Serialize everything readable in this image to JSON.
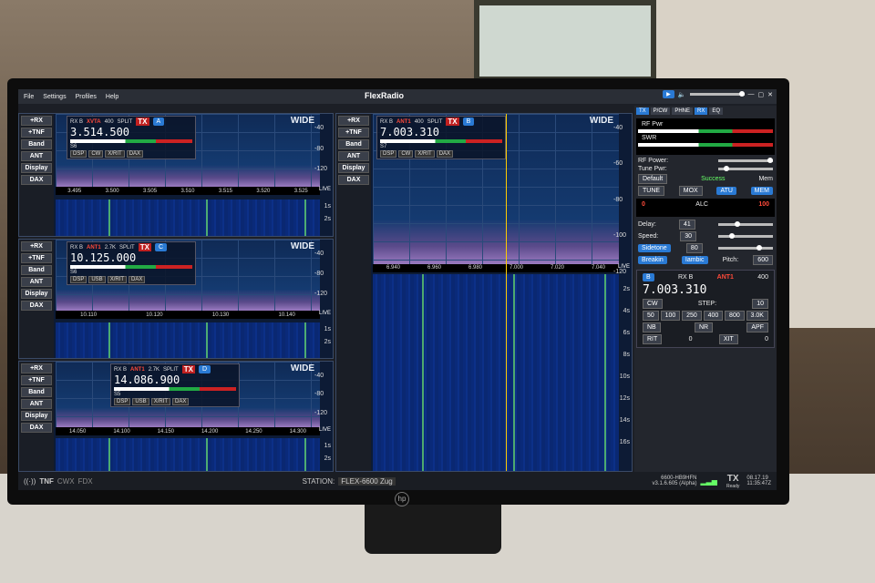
{
  "menu": {
    "file": "File",
    "settings": "Settings",
    "profiles": "Profiles",
    "help": "Help",
    "brand": "FlexRadio"
  },
  "side_buttons": [
    "+RX",
    "+TNF",
    "Band",
    "ANT",
    "Display",
    "DAX"
  ],
  "pan1": {
    "wide": "WIDE",
    "rx": "RX B",
    "ant": "XVTA",
    "bw": "400",
    "split": "SPLIT",
    "tx": "TX",
    "letter": "A",
    "freq": "3.514.500",
    "smeter": "S6",
    "modes": [
      "DSP",
      "CW",
      "X/RIT",
      "DAX"
    ],
    "scale": [
      "-40",
      "-80",
      "-120"
    ],
    "ticks": [
      "3.495",
      "3.500",
      "3.505",
      "3.510",
      "3.515",
      "3.520",
      "3.525"
    ],
    "times": [
      "1s",
      "2s"
    ]
  },
  "pan2": {
    "wide": "WIDE",
    "rx": "RX B",
    "ant": "ANT1",
    "bw": "2.7K",
    "split": "SPLIT",
    "tx": "TX",
    "letter": "C",
    "freq": "10.125.000",
    "smeter": "S6",
    "modes": [
      "DSP",
      "USB",
      "X/RIT",
      "DAX"
    ],
    "scale": [
      "-40",
      "-80",
      "-120"
    ],
    "ticks": [
      "10.110",
      "10.120",
      "10.130",
      "10.140"
    ],
    "times": [
      "1s",
      "2s"
    ]
  },
  "pan3": {
    "wide": "WIDE",
    "rx": "RX B",
    "ant": "ANT1",
    "bw": "2.7K",
    "split": "SPLIT",
    "tx": "TX",
    "letter": "D",
    "freq": "14.086.900",
    "smeter": "S5",
    "modes": [
      "DSP",
      "USB",
      "X/RIT",
      "DAX"
    ],
    "scale": [
      "-40",
      "-80",
      "-120"
    ],
    "ticks": [
      "14.050",
      "14.100",
      "14.150",
      "14.200",
      "14.250",
      "14.300"
    ],
    "times": [
      "1s",
      "2s"
    ]
  },
  "pan4": {
    "wide": "WIDE",
    "rx": "RX B",
    "ant": "ANT1",
    "bw": "400",
    "split": "SPLIT",
    "tx": "TX",
    "letter": "B",
    "freq": "7.003.310",
    "smeter": "S7",
    "modes": [
      "DSP",
      "CW",
      "X/RIT",
      "DAX"
    ],
    "scale": [
      "-40",
      "-60",
      "-80",
      "-100",
      "-120"
    ],
    "ticks": [
      "6.940",
      "6.960",
      "6.980",
      "7.000",
      "7.020",
      "7.040"
    ],
    "times": [
      "2s",
      "4s",
      "6s",
      "8s",
      "10s",
      "12s",
      "14s",
      "16s"
    ]
  },
  "live": "LIVE",
  "right": {
    "tabs": [
      "TX",
      "P/CW",
      "PHNE",
      "RX",
      "EQ"
    ],
    "rfpwr": "RF Pwr",
    "swr": "SWR",
    "rf_power": "RF Power:",
    "tune_pwr": "Tune Pwr:",
    "profile": "Default",
    "success": "Success",
    "mem": "Mem",
    "tune": "TUNE",
    "mox": "MOX",
    "atu": "ATU",
    "memb": "MEM",
    "alc": "ALC",
    "alc_max": "100",
    "alc_min": "0",
    "delay": "Delay:",
    "delay_v": "41",
    "speed": "Speed:",
    "speed_v": "30",
    "sidetone": "Sidetone",
    "sidetone_v": "80",
    "breakin": "Breakin",
    "iambic": "Iambic",
    "pitch": "Pitch:",
    "pitch_v": "600",
    "vfo_letter": "B",
    "vfo_rx": "RX B",
    "vfo_ant": "ANT1",
    "vfo_bw": "400",
    "vfo_freq": "7.003.310",
    "vfo_mode": "CW",
    "step": "STEP:",
    "step_v": "10",
    "bw_btns": [
      "50",
      "100",
      "250",
      "400",
      "800",
      "3.0K"
    ],
    "nb": "NB",
    "nr": "NR",
    "apf": "APF",
    "rit": "RIT",
    "xit": "XIT",
    "zero": "0"
  },
  "status": {
    "tnf": "TNF",
    "cwx": "CWX",
    "fdx": "FDX",
    "station_lbl": "STATION:",
    "station": "FLEX-6600 Zug",
    "model": "6600-HB9HFN",
    "ver": "v3.1.6.605 (Alpha)",
    "tx": "TX",
    "ready": "Ready",
    "date": "08.17.19",
    "time": "11:35:47Z"
  },
  "hp": "hp"
}
